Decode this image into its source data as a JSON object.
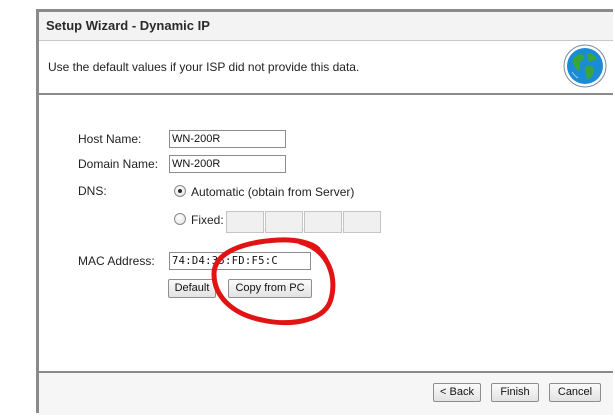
{
  "wizard": {
    "title": "Setup Wizard - Dynamic IP",
    "description": "Use the default values if your ISP did not provide this data."
  },
  "form": {
    "host_name": {
      "label": "Host Name:",
      "value": "WN-200R"
    },
    "domain_name": {
      "label": "Domain Name:",
      "value": "WN-200R"
    },
    "dns": {
      "label": "DNS:",
      "automatic_label": "Automatic (obtain from Server)",
      "fixed_label": "Fixed:",
      "selected": "automatic"
    },
    "mac_address": {
      "label": "MAC Address:",
      "value": "74:D4:35:FD:F5:C"
    },
    "default_button": "Default",
    "copy_button": "Copy from PC"
  },
  "footer": {
    "back_button": "< Back",
    "finish_button": "Finish",
    "cancel_button": "Cancel"
  },
  "colors": {
    "frame": "#8a8a8a",
    "annotation_stroke": "#e11414",
    "globe_blue": "#1a8bd6",
    "globe_land": "#3aa63a"
  },
  "icons": {
    "wizard_icon": "globe-icon"
  }
}
